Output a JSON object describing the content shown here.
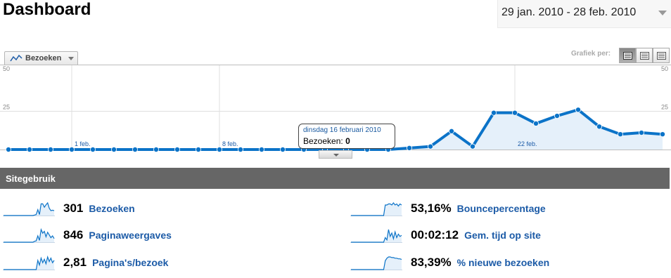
{
  "header": {
    "title": "Dashboard",
    "date_range": "29 jan. 2010 - 28 feb. 2010"
  },
  "graph_controls": {
    "metric_selector": "Bezoeken",
    "graph_by_label": "Grafiek per:",
    "view_options": [
      "day-view-icon",
      "week-view-icon",
      "month-view-icon"
    ],
    "active_view_index": 0
  },
  "chart_data": {
    "type": "area",
    "y_tick_labels_left": [
      "50",
      "25"
    ],
    "y_tick_labels_right": [
      "50",
      "25"
    ],
    "ylim": [
      0,
      50
    ],
    "x_tick_labels": [
      "1 feb.",
      "8 feb.",
      "22 feb."
    ],
    "x_tick_positions": [
      3,
      10,
      24
    ],
    "grid": true,
    "series": [
      {
        "values": [
          0,
          0,
          0,
          0,
          0,
          0,
          0,
          0,
          0,
          0,
          0,
          0,
          0,
          0,
          0,
          0,
          0,
          0,
          0,
          1,
          2,
          12,
          2,
          24,
          24,
          17,
          22,
          26,
          15,
          10,
          11,
          10
        ]
      }
    ],
    "colors": {
      "line": "#0b73c8",
      "fill": "#e5f0fa",
      "grid": "#dfdfdf"
    }
  },
  "tooltip": {
    "date": "dinsdag 16 februari 2010",
    "metric": "Bezoeken:",
    "value": "0"
  },
  "site_usage": {
    "title": "Sitegebruik",
    "stats": [
      {
        "value": "301",
        "label": "Bezoeken",
        "spark": [
          0,
          0,
          0,
          0,
          0,
          0,
          0,
          0,
          0,
          0,
          0,
          0,
          0,
          0,
          0,
          0,
          0,
          0,
          0,
          1,
          2,
          12,
          2,
          24,
          24,
          17,
          22,
          26,
          15,
          10,
          11,
          10
        ]
      },
      {
        "value": "846",
        "label": "Paginaweergaves",
        "spark": [
          0,
          0,
          0,
          0,
          0,
          0,
          0,
          0,
          0,
          0,
          0,
          0,
          0,
          0,
          0,
          0,
          0,
          0,
          0,
          2,
          3,
          14,
          4,
          28,
          20,
          24,
          12,
          22,
          16,
          10,
          14,
          8
        ]
      },
      {
        "value": "2,81",
        "label": "Pagina's/bezoek",
        "spark": [
          0,
          0,
          0,
          0,
          0,
          0,
          0,
          0,
          0,
          0,
          0,
          0,
          0,
          0,
          0,
          0,
          0,
          0,
          0,
          0,
          0,
          16,
          8,
          20,
          12,
          18,
          10,
          22,
          14,
          20,
          12,
          16
        ]
      },
      {
        "value": "53,16%",
        "label": "Bouncepercentage",
        "spark": [
          0,
          0,
          0,
          0,
          0,
          0,
          0,
          0,
          0,
          0,
          0,
          0,
          0,
          0,
          0,
          0,
          0,
          0,
          0,
          0,
          0,
          20,
          20,
          22,
          22,
          20,
          24,
          20,
          22,
          18,
          22,
          20
        ]
      },
      {
        "value": "00:02:12",
        "label": "Gem. tijd op site",
        "spark": [
          0,
          0,
          0,
          0,
          0,
          0,
          0,
          0,
          0,
          0,
          0,
          0,
          0,
          0,
          0,
          0,
          0,
          0,
          0,
          0,
          0,
          8,
          4,
          22,
          10,
          16,
          6,
          18,
          8,
          14,
          10,
          12
        ]
      },
      {
        "value": "83,39%",
        "label": "% nieuwe bezoeken",
        "spark": [
          0,
          0,
          0,
          0,
          0,
          0,
          0,
          0,
          0,
          0,
          0,
          0,
          0,
          0,
          0,
          0,
          0,
          0,
          0,
          0,
          0,
          14,
          18,
          20,
          20,
          19,
          19,
          18,
          18,
          17,
          17,
          16
        ]
      }
    ],
    "colors": {
      "spark_line": "#0b73c8",
      "spark_fill": "#e5f0fa",
      "label": "#1c5ba7",
      "header_bg": "#666666"
    }
  }
}
